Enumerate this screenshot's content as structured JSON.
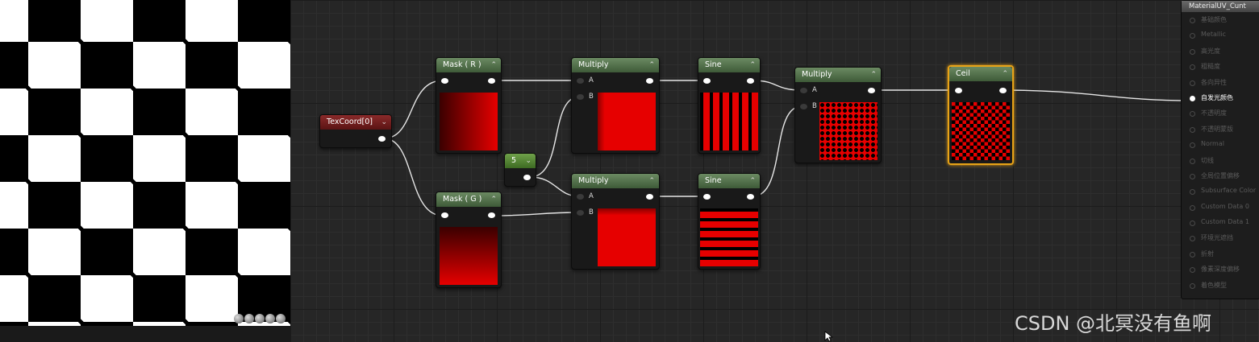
{
  "nodes": {
    "texcoord": {
      "title": "TexCoord[0]"
    },
    "mask_r": {
      "title": "Mask ( R )"
    },
    "mask_g": {
      "title": "Mask ( G )"
    },
    "const": {
      "title": "5"
    },
    "multiply_top": {
      "title": "Multiply",
      "pin_a": "A",
      "pin_b": "B"
    },
    "multiply_bottom": {
      "title": "Multiply",
      "pin_a": "A",
      "pin_b": "B"
    },
    "sine_top": {
      "title": "Sine"
    },
    "sine_bottom": {
      "title": "Sine"
    },
    "multiply_final": {
      "title": "Multiply",
      "pin_a": "A",
      "pin_b": "B"
    },
    "ceil": {
      "title": "Ceil"
    }
  },
  "result_node": {
    "title": "MaterialUV_Cunt",
    "pins": [
      {
        "label": "基础颜色",
        "active": false
      },
      {
        "label": "Metallic",
        "active": false
      },
      {
        "label": "高光度",
        "active": false
      },
      {
        "label": "粗糙度",
        "active": false
      },
      {
        "label": "各向异性",
        "active": false
      },
      {
        "label": "自发光颜色",
        "active": true
      },
      {
        "label": "不透明度",
        "active": false
      },
      {
        "label": "不透明蒙版",
        "active": false
      },
      {
        "label": "Normal",
        "active": false
      },
      {
        "label": "切线",
        "active": false
      },
      {
        "label": "全局位置偏移",
        "active": false
      },
      {
        "label": "Subsurface Color",
        "active": false
      },
      {
        "label": "Custom Data 0",
        "active": false
      },
      {
        "label": "Custom Data 1",
        "active": false
      },
      {
        "label": "环境光遮挡",
        "active": false
      },
      {
        "label": "折射",
        "active": false
      },
      {
        "label": "像素深度偏移",
        "active": false
      },
      {
        "label": "着色模型",
        "active": false
      }
    ]
  },
  "watermark": "CSDN @北冥没有鱼啊",
  "colors": {
    "node_green": "#4f6e47",
    "selected_outline": "#e8a317",
    "preview_red": "#e60000",
    "texcoord_red": "#7a1e1e"
  },
  "viewport": {
    "preview": "checkerboard black/white"
  }
}
